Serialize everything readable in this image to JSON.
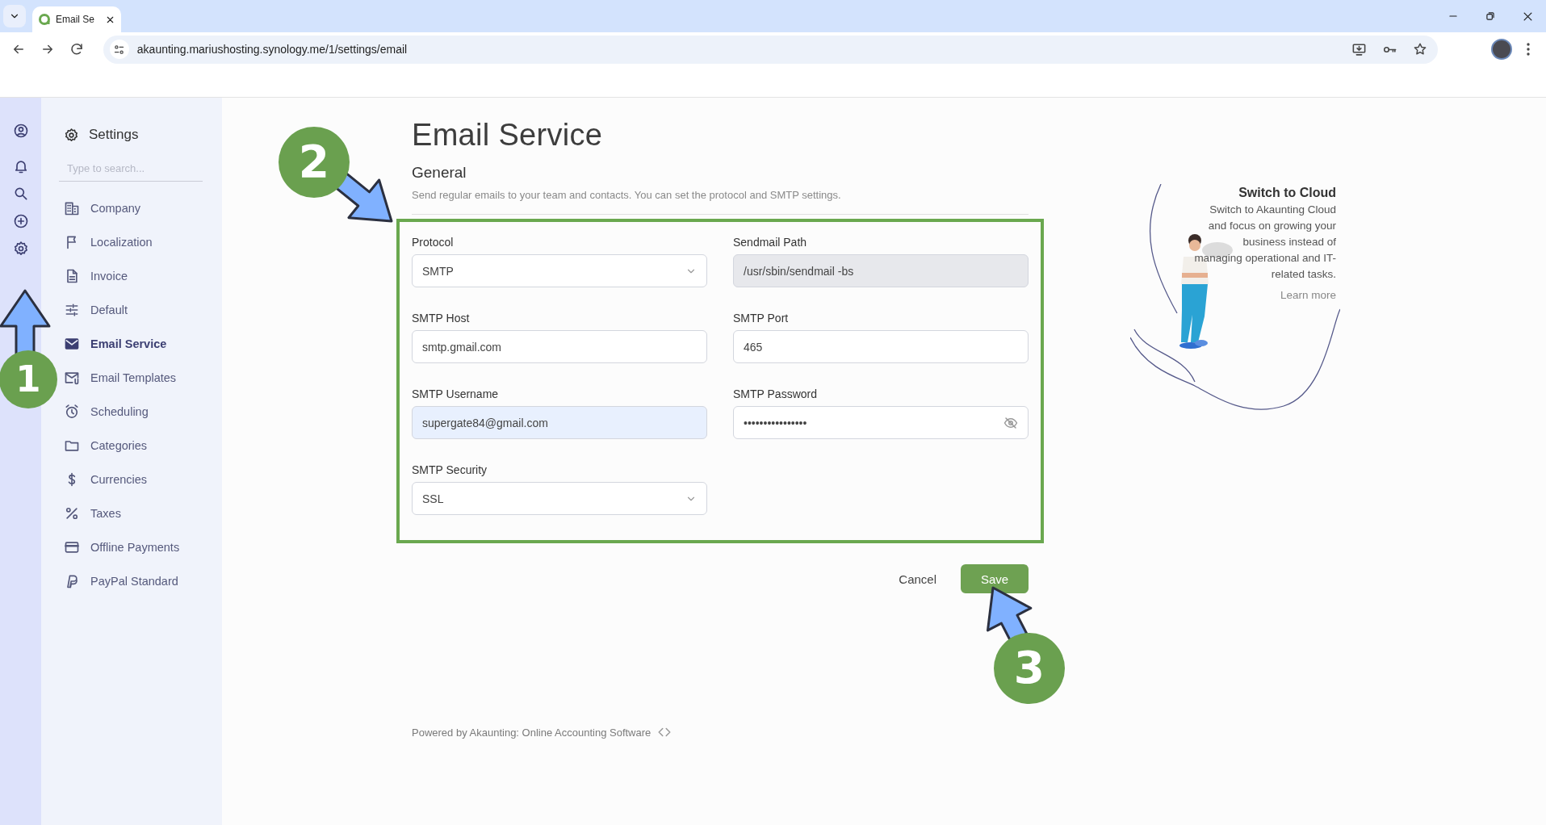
{
  "browser": {
    "tab": {
      "title": "Email Se"
    },
    "address": "akaunting.mariushosting.synology.me/1/settings/email"
  },
  "settings_nav": {
    "title": "Settings",
    "search": {
      "placeholder": "Type to search..."
    },
    "items": [
      {
        "label": "Company",
        "selected": false
      },
      {
        "label": "Localization",
        "selected": false
      },
      {
        "label": "Invoice",
        "selected": false
      },
      {
        "label": "Default",
        "selected": false
      },
      {
        "label": "Email Service",
        "selected": true
      },
      {
        "label": "Email Templates",
        "selected": false
      },
      {
        "label": "Scheduling",
        "selected": false
      },
      {
        "label": "Categories",
        "selected": false
      },
      {
        "label": "Currencies",
        "selected": false
      },
      {
        "label": "Taxes",
        "selected": false
      },
      {
        "label": "Offline Payments",
        "selected": false
      },
      {
        "label": "PayPal Standard",
        "selected": false
      }
    ]
  },
  "page": {
    "title": "Email Service",
    "section": "General",
    "description": "Send regular emails to your team and contacts. You can set the protocol and SMTP settings.",
    "fields": [
      {
        "label": "Protocol",
        "kind": "select",
        "value": "SMTP",
        "disabled": false,
        "autofilled": false
      },
      {
        "label": "Sendmail Path",
        "kind": "text",
        "value": "/usr/sbin/sendmail -bs",
        "disabled": true,
        "autofilled": false
      },
      {
        "label": "SMTP Host",
        "kind": "text",
        "value": "smtp.gmail.com",
        "disabled": false,
        "autofilled": false
      },
      {
        "label": "SMTP Port",
        "kind": "text",
        "value": "465",
        "disabled": false,
        "autofilled": false
      },
      {
        "label": "SMTP Username",
        "kind": "text",
        "value": "supergate84@gmail.com",
        "disabled": false,
        "autofilled": true
      },
      {
        "label": "SMTP Password",
        "kind": "password",
        "value": "••••••••••••••••",
        "disabled": false,
        "autofilled": false
      },
      {
        "label": "SMTP Security",
        "kind": "select",
        "value": "SSL",
        "disabled": false,
        "autofilled": false
      }
    ],
    "buttons": {
      "cancel": "Cancel",
      "save": "Save"
    },
    "footer": "Powered by Akaunting: Online Accounting Software"
  },
  "promo": {
    "title": "Switch to Cloud",
    "text": "Switch to Akaunting Cloud and focus on growing your business instead of managing operational and IT-related tasks.",
    "link": "Learn more"
  },
  "annotations": [
    {
      "number": "1"
    },
    {
      "number": "2"
    },
    {
      "number": "3"
    }
  ]
}
